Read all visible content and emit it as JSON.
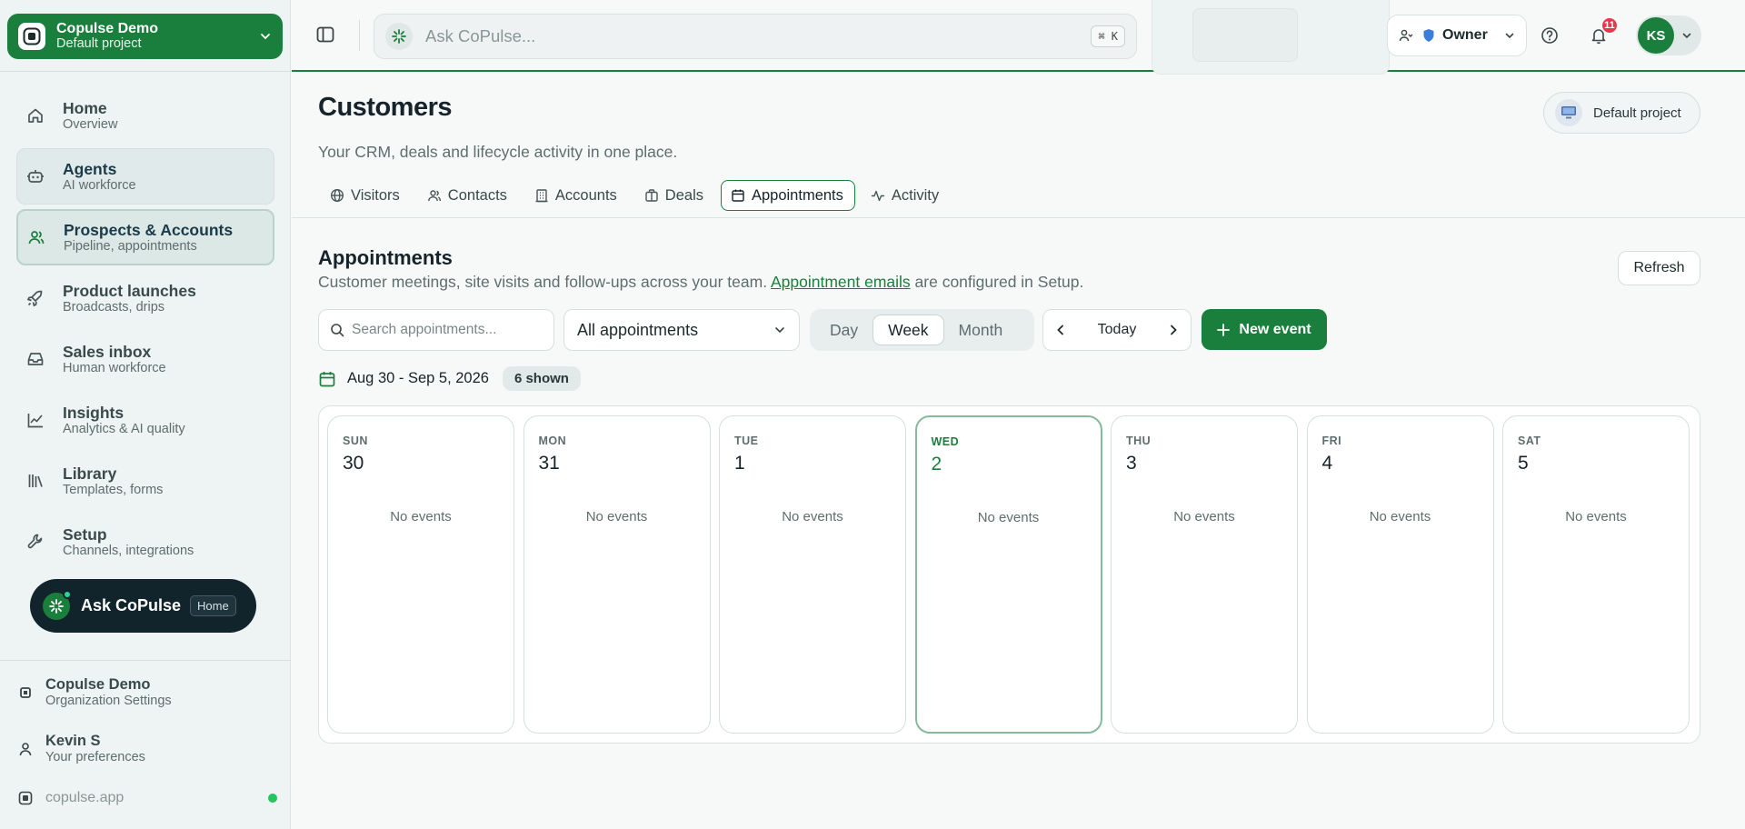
{
  "workspace": {
    "name": "Copulse Demo",
    "project": "Default project"
  },
  "nav": [
    {
      "id": "home",
      "icon": "home-icon",
      "title": "Home",
      "sub": "Overview",
      "state": ""
    },
    {
      "id": "agents",
      "icon": "bot-icon",
      "title": "Agents",
      "sub": "AI workforce",
      "state": "hover"
    },
    {
      "id": "prospects",
      "icon": "users-icon",
      "title": "Prospects & Accounts",
      "sub": "Pipeline, appointments",
      "state": "active"
    },
    {
      "id": "launches",
      "icon": "rocket-icon",
      "title": "Product launches",
      "sub": "Broadcasts, drips",
      "state": ""
    },
    {
      "id": "inbox",
      "icon": "inbox-icon",
      "title": "Sales inbox",
      "sub": "Human workforce",
      "state": ""
    },
    {
      "id": "insights",
      "icon": "chart-line-icon",
      "title": "Insights",
      "sub": "Analytics & AI quality",
      "state": ""
    },
    {
      "id": "library",
      "icon": "library-icon",
      "title": "Library",
      "sub": "Templates, forms",
      "state": ""
    },
    {
      "id": "setup",
      "icon": "wrench-icon",
      "title": "Setup",
      "sub": "Channels, integrations",
      "state": ""
    }
  ],
  "ask_pill": {
    "label": "Ask CoPulse",
    "badge": "Home"
  },
  "footer": {
    "org": {
      "title": "Copulse Demo",
      "sub": "Organization Settings"
    },
    "user": {
      "title": "Kevin S",
      "sub": "Your preferences"
    },
    "domain": "copulse.app"
  },
  "topbar": {
    "search_placeholder": "Ask CoPulse...",
    "shortcut": "⌘ K",
    "role": "Owner",
    "notifications": "11",
    "avatar_initials": "KS"
  },
  "page": {
    "title": "Customers",
    "subtitle": "Your CRM, deals and lifecycle activity in one place.",
    "project_button": "Default project"
  },
  "tabs": [
    {
      "id": "visitors",
      "label": "Visitors",
      "icon": "globe-icon",
      "active": false
    },
    {
      "id": "contacts",
      "label": "Contacts",
      "icon": "contacts-icon",
      "active": false
    },
    {
      "id": "accounts",
      "label": "Accounts",
      "icon": "building-icon",
      "active": false
    },
    {
      "id": "deals",
      "label": "Deals",
      "icon": "briefcase-icon",
      "active": false
    },
    {
      "id": "appointments",
      "label": "Appointments",
      "icon": "calendar-icon",
      "active": true
    },
    {
      "id": "activity",
      "label": "Activity",
      "icon": "activity-icon",
      "active": false
    }
  ],
  "appointments": {
    "title": "Appointments",
    "subtitle_before": "Customer meetings, site visits and follow-ups across your team. ",
    "subtitle_link": "Appointment emails",
    "subtitle_after": " are configured in Setup.",
    "refresh_label": "Refresh",
    "search_placeholder": "Search appointments...",
    "filter_value": "All appointments",
    "views": [
      {
        "label": "Day",
        "active": false
      },
      {
        "label": "Week",
        "active": true
      },
      {
        "label": "Month",
        "active": false
      }
    ],
    "today_label": "Today",
    "new_event_label": "New event",
    "range": "Aug 30 - Sep 5, 2026",
    "shown": "6 shown",
    "empty_label": "No events",
    "days": [
      {
        "name": "SUN",
        "num": "30",
        "today": false
      },
      {
        "name": "MON",
        "num": "31",
        "today": false
      },
      {
        "name": "TUE",
        "num": "1",
        "today": false
      },
      {
        "name": "WED",
        "num": "2",
        "today": true
      },
      {
        "name": "THU",
        "num": "3",
        "today": false
      },
      {
        "name": "FRI",
        "num": "4",
        "today": false
      },
      {
        "name": "SAT",
        "num": "5",
        "today": false
      }
    ]
  },
  "colors": {
    "brand": "#1a7f3c",
    "badge": "#e8364f",
    "status_online": "#22c55e",
    "pill_dark": "#11242b"
  }
}
